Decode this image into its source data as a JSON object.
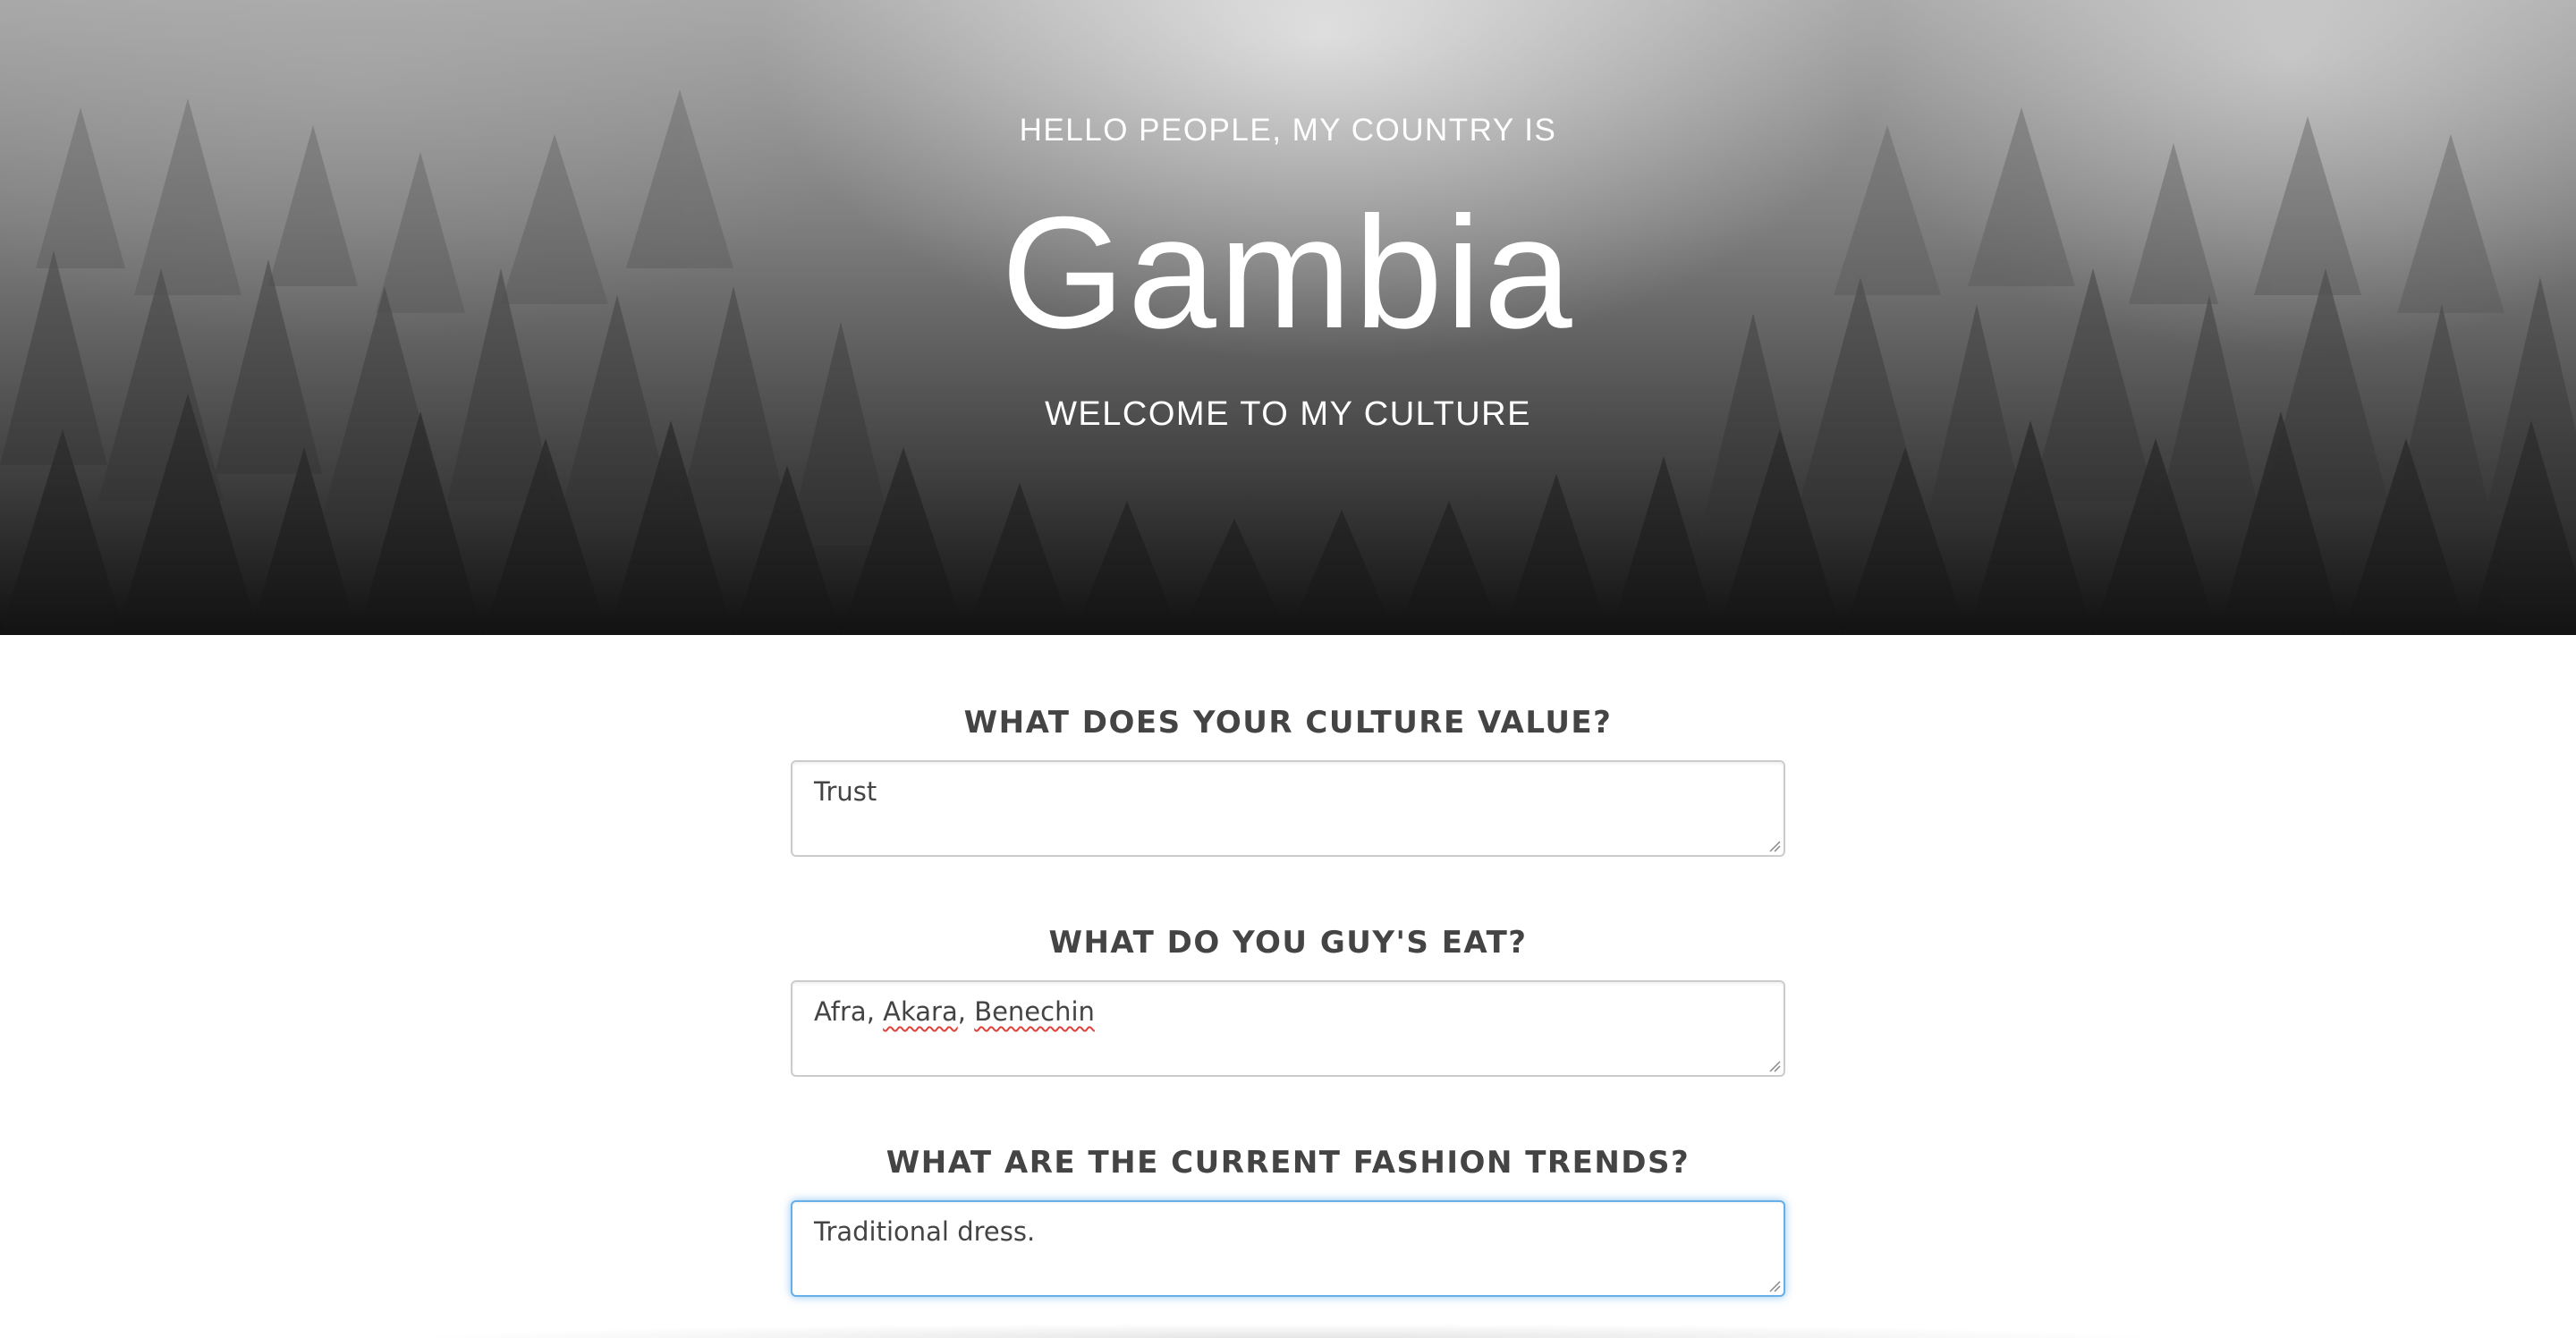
{
  "hero": {
    "kicker": "HELLO PEOPLE, MY COUNTRY IS",
    "title": "Gambia",
    "subtitle": "WELCOME TO MY CULTURE"
  },
  "questions": [
    {
      "label": "WHAT DOES YOUR CULTURE VALUE?",
      "value": "Trust"
    },
    {
      "label": "WHAT DO YOU GUY'S EAT?",
      "value_parts": [
        "Afra, ",
        "Akara",
        ", ",
        "Benechin"
      ]
    },
    {
      "label": "WHAT ARE THE CURRENT FASHION TRENDS?",
      "value": "Traditional dress."
    }
  ],
  "colors": {
    "focus_accent": "#66afe9",
    "label_text": "#444444",
    "spellcheck": "#e0403a"
  }
}
